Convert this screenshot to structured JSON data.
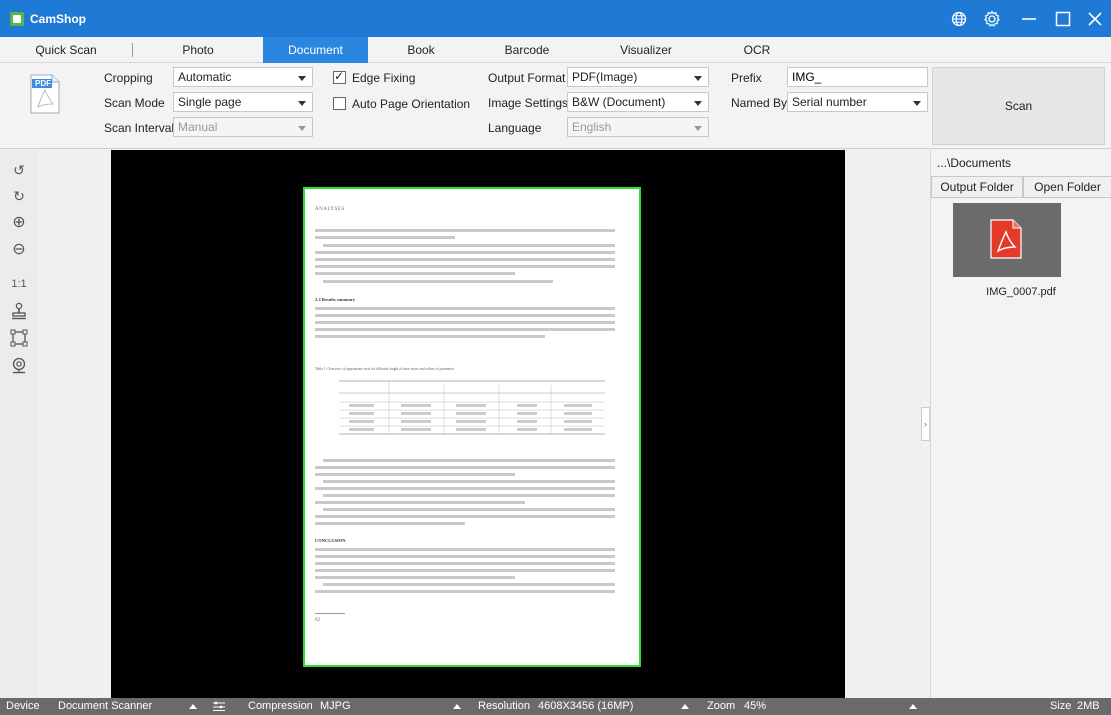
{
  "app": {
    "title": "CamShop"
  },
  "window_controls": {
    "web_icon": "globe-icon",
    "settings_icon": "gear-icon",
    "minimize_icon": "minimize-icon",
    "maximize_icon": "maximize-icon",
    "close_icon": "close-icon"
  },
  "tabs": [
    {
      "label": "Quick Scan",
      "active": false
    },
    {
      "label": "Photo",
      "active": false
    },
    {
      "label": "Document",
      "active": true
    },
    {
      "label": "Book",
      "active": false
    },
    {
      "label": "Barcode",
      "active": false
    },
    {
      "label": "Visualizer",
      "active": false
    },
    {
      "label": "OCR",
      "active": false
    }
  ],
  "settings": {
    "pdf_icon_text": "PDF",
    "cropping": {
      "label": "Cropping",
      "value": "Automatic"
    },
    "scan_mode": {
      "label": "Scan Mode",
      "value": "Single page"
    },
    "scan_interval": {
      "label": "Scan Interval",
      "value": "Manual"
    },
    "edge_fixing": {
      "label": "Edge Fixing",
      "checked": true
    },
    "auto_page_orientation": {
      "label": "Auto Page Orientation",
      "checked": false
    },
    "output_format": {
      "label": "Output Format",
      "value": "PDF(Image)"
    },
    "image_settings": {
      "label": "Image Settings",
      "value": "B&W (Document)"
    },
    "language": {
      "label": "Language",
      "value": "English"
    },
    "prefix": {
      "label": "Prefix",
      "value": "IMG_"
    },
    "named_by": {
      "label": "Named By",
      "value": "Serial number"
    },
    "scan_button": "Scan"
  },
  "left_toolbar": [
    {
      "icon": "rotate-left-icon",
      "glyph": "↺"
    },
    {
      "icon": "rotate-right-icon",
      "glyph": "↻"
    },
    {
      "icon": "zoom-in-icon",
      "glyph": "⊕"
    },
    {
      "icon": "zoom-out-icon",
      "glyph": "⊖"
    },
    {
      "icon": "actual-size-icon",
      "glyph": "1:1"
    },
    {
      "icon": "stamp-icon",
      "glyph": ""
    },
    {
      "icon": "crop-icon",
      "glyph": ""
    },
    {
      "icon": "webcam-icon",
      "glyph": ""
    }
  ],
  "document_preview": {
    "heading": "ANALYSES",
    "section_title": "2.3 Results summary",
    "table_caption": "Table 1: Overview of appropriate tests for different length of time series and values of parameter",
    "conclusion_title": "CONCLUSION",
    "page_number": "62"
  },
  "right_panel": {
    "path": "...\\Documents",
    "output_folder_button": "Output Folder",
    "open_folder_button": "Open Folder",
    "files": [
      {
        "name": "IMG_0007.pdf"
      }
    ]
  },
  "status": {
    "device_label": "Device",
    "device_value": "Document Scanner",
    "compression_label": "Compression",
    "compression_value": "MJPG",
    "resolution_label": "Resolution",
    "resolution_value": "4608X3456 (16MP)",
    "zoom_label": "Zoom",
    "zoom_value": "45%",
    "size_label": "Size",
    "size_value": "2MB"
  },
  "colors": {
    "titlebar": "#1f7ad6",
    "active_tab": "#2b86e0",
    "crop_border": "#2ee02e",
    "viewer_bg": "#000000",
    "status_bar": "#6a6a6a"
  }
}
